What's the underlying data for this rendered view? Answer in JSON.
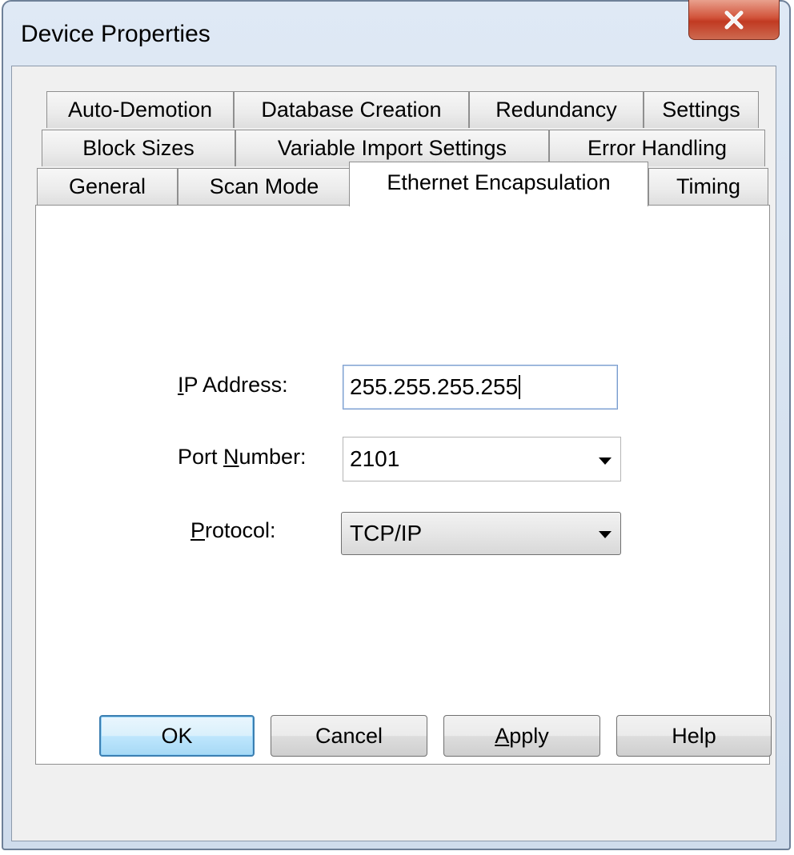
{
  "window": {
    "title": "Device Properties",
    "close_symbol": "x"
  },
  "tabs": {
    "row1": [
      "Auto-Demotion",
      "Database Creation",
      "Redundancy",
      "Settings"
    ],
    "row2": [
      "Block Sizes",
      "Variable Import Settings",
      "Error Handling"
    ],
    "row3": [
      "General",
      "Scan Mode",
      "Ethernet Encapsulation",
      "Timing"
    ],
    "active": "Ethernet Encapsulation"
  },
  "form": {
    "ip_label_mnemonic": "I",
    "ip_label_rest": "P Address:",
    "ip_value": "255.255.255.255",
    "port_label_before": "Port ",
    "port_label_mnemonic": "N",
    "port_label_after": "umber:",
    "port_value": "2101",
    "protocol_label_mnemonic": "P",
    "protocol_label_rest": "rotocol:",
    "protocol_value": "TCP/IP"
  },
  "buttons": {
    "ok": "OK",
    "cancel": "Cancel",
    "apply_mnemonic": "A",
    "apply_rest": "pply",
    "help": "Help"
  },
  "colors": {
    "close_red": "#c13a22",
    "default_button_border": "#3c7fb1",
    "frame": "#dfe9f5"
  }
}
